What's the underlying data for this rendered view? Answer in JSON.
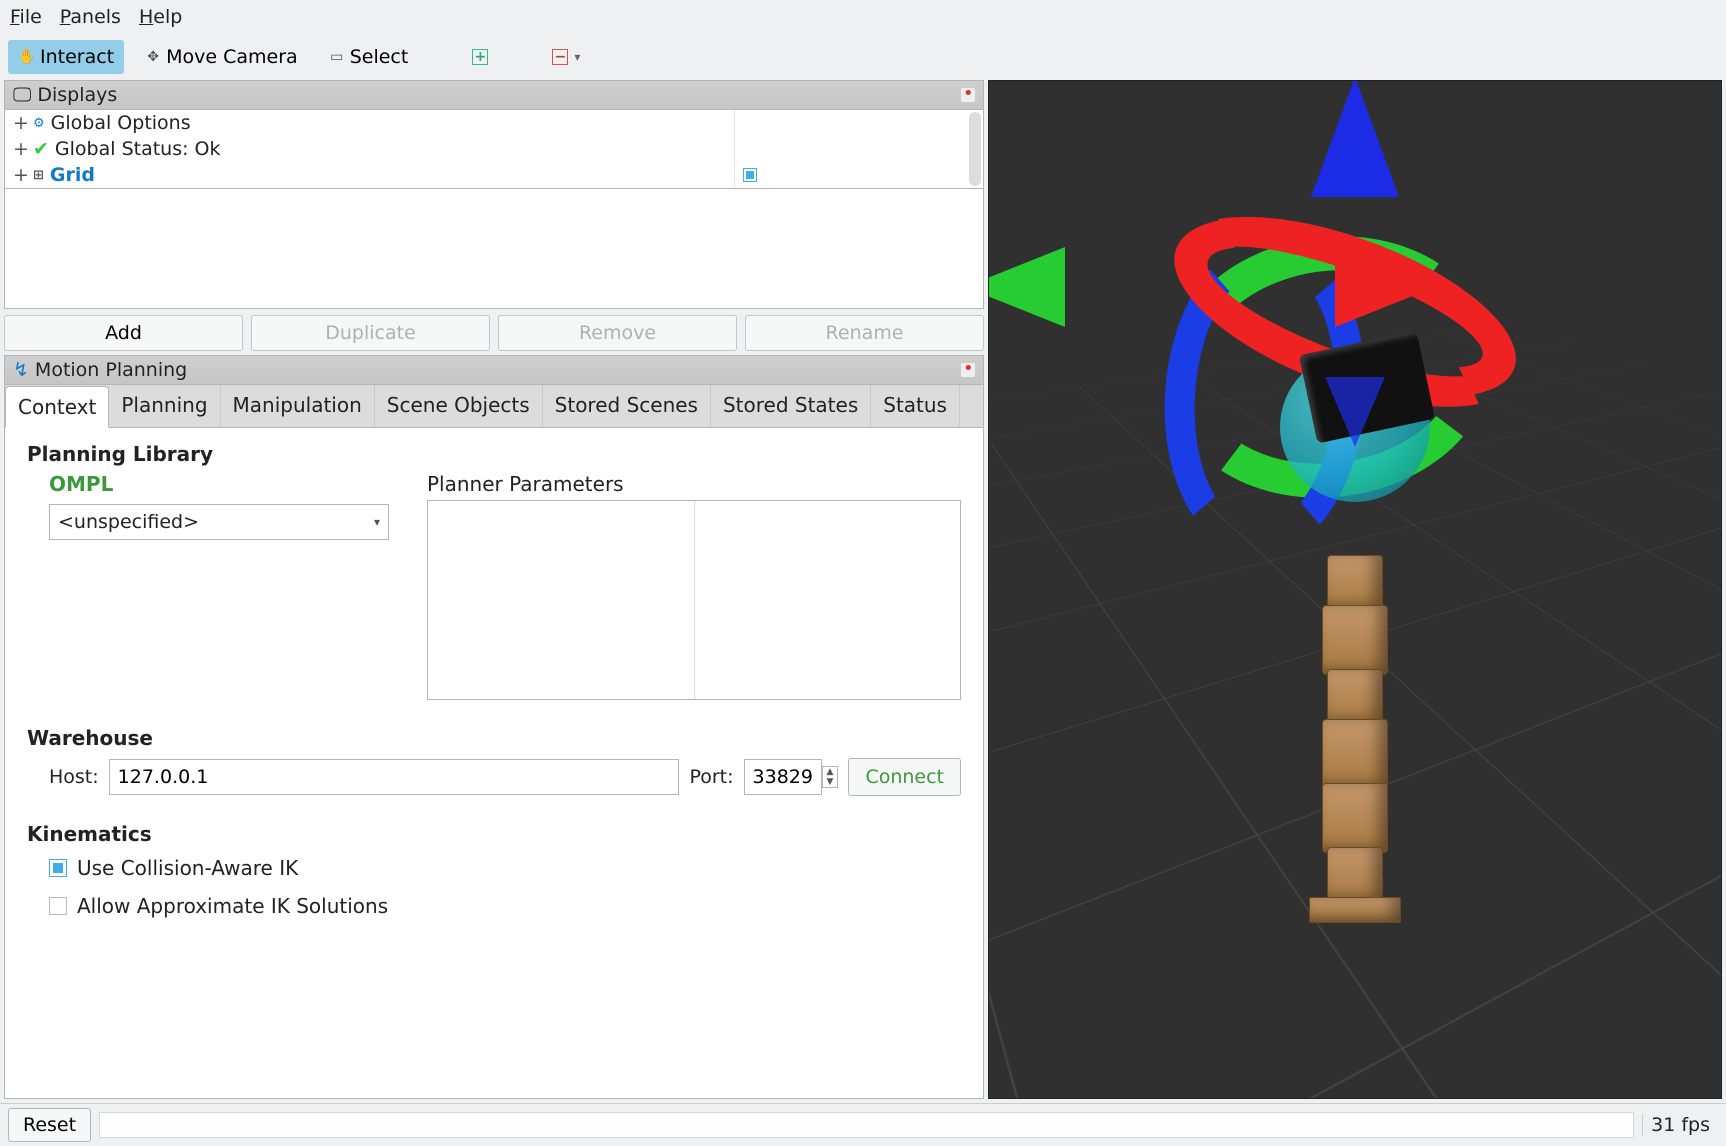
{
  "menu": {
    "file": "File",
    "panels": "Panels",
    "help": "Help"
  },
  "toolbar": {
    "interact": "Interact",
    "move_camera": "Move Camera",
    "select": "Select"
  },
  "displays_panel": {
    "title": "Displays",
    "items": [
      {
        "label": "Global Options"
      },
      {
        "label": "Global Status: Ok"
      },
      {
        "label": "Grid",
        "checked": true
      }
    ],
    "buttons": {
      "add": "Add",
      "duplicate": "Duplicate",
      "remove": "Remove",
      "rename": "Rename"
    }
  },
  "motion_panel": {
    "title": "Motion Planning",
    "tabs": [
      "Context",
      "Planning",
      "Manipulation",
      "Scene Objects",
      "Stored Scenes",
      "Stored States",
      "Status"
    ],
    "active_tab": 0,
    "planning_library": {
      "title": "Planning Library",
      "lib": "OMPL",
      "planner_params_title": "Planner Parameters",
      "selected": "<unspecified>"
    },
    "warehouse": {
      "title": "Warehouse",
      "host_label": "Host:",
      "host_value": "127.0.0.1",
      "port_label": "Port:",
      "port_value": "33829",
      "connect": "Connect"
    },
    "kinematics": {
      "title": "Kinematics",
      "collision_ik": "Use Collision-Aware IK",
      "approx_ik": "Allow Approximate IK Solutions"
    }
  },
  "statusbar": {
    "reset": "Reset",
    "fps": "31 fps"
  }
}
